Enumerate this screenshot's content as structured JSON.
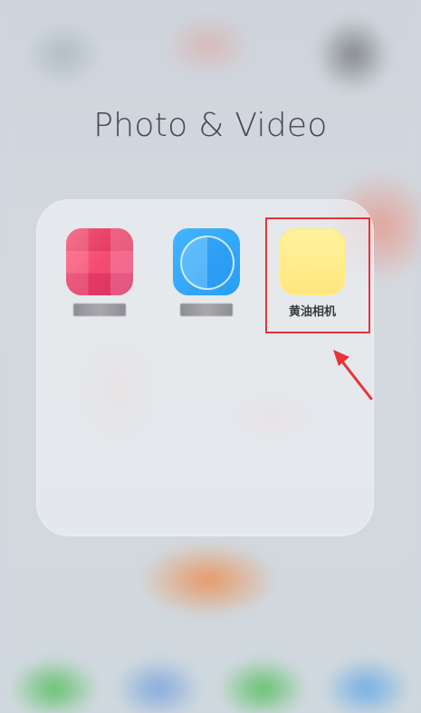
{
  "folder": {
    "title": "Photo & Video",
    "apps": [
      {
        "label": "",
        "icon": "pink-mosaic-app-icon",
        "label_blurred": true,
        "color": "#f23e68"
      },
      {
        "label": "",
        "icon": "blue-circle-app-icon",
        "label_blurred": true,
        "color": "#279ef5"
      },
      {
        "label": "黄油相机",
        "icon": "butter-camera-app-icon",
        "label_blurred": false,
        "color": "#ffe57e"
      }
    ]
  },
  "annotation": {
    "color": "#e8333a",
    "target": "butter-camera-app"
  }
}
